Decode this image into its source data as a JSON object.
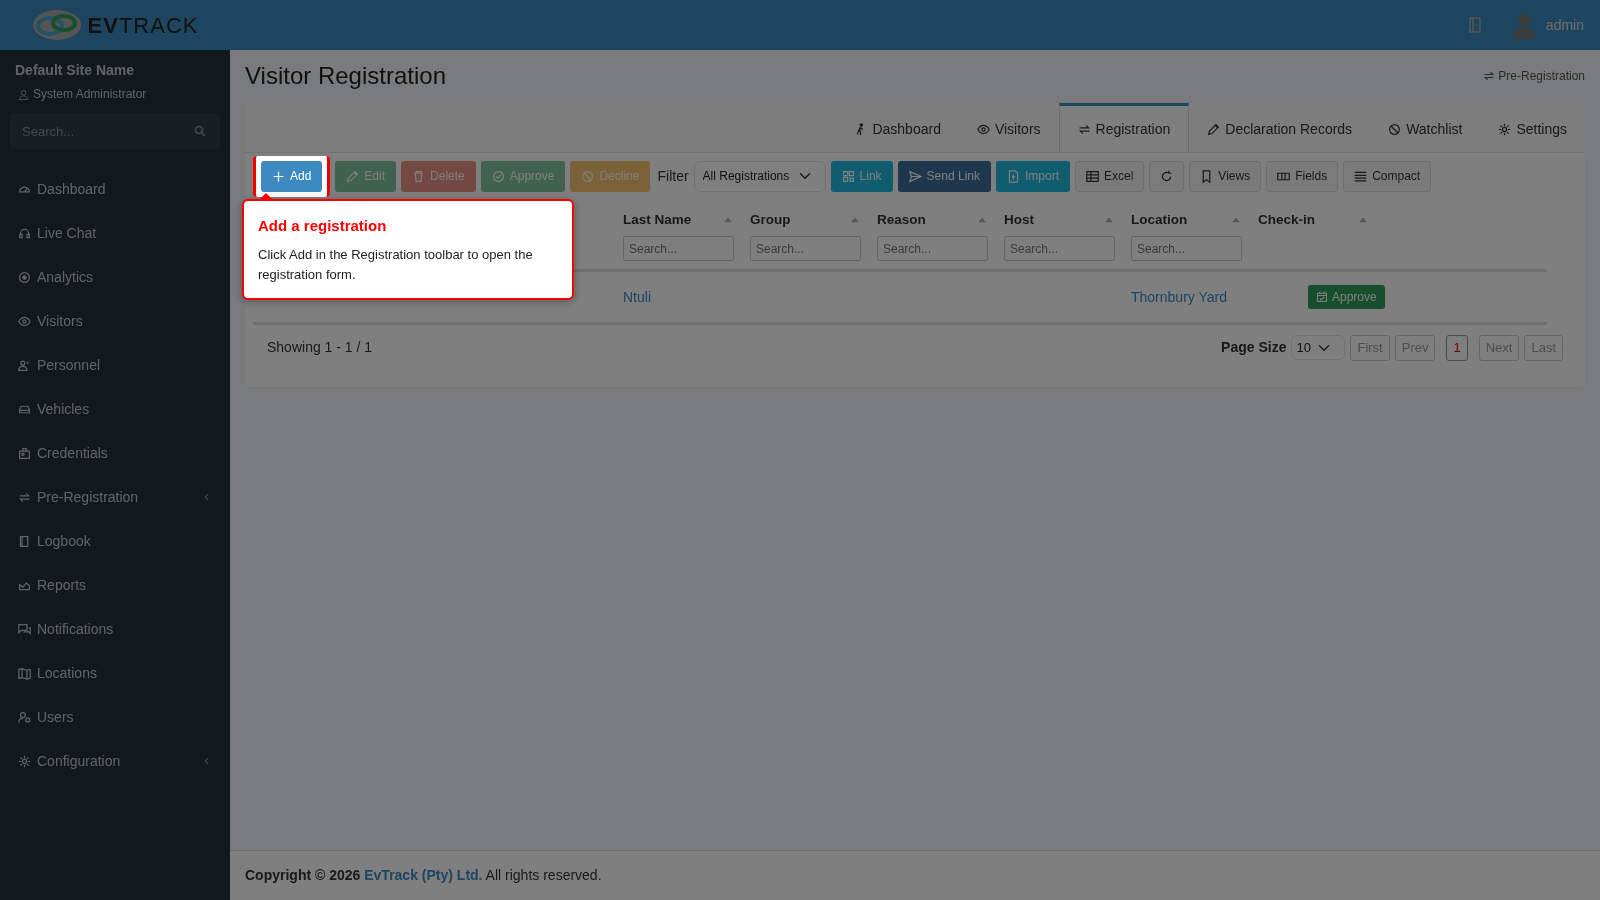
{
  "header": {
    "logo_text": "**EV**TRACK",
    "user": "admin"
  },
  "sidebar": {
    "site_name": "Default Site Name",
    "role": "System Administrator",
    "search": {
      "placeholder": "Search..."
    },
    "items": [
      {
        "label": "Dashboard",
        "has_submenu": false
      },
      {
        "label": "Live Chat",
        "has_submenu": false
      },
      {
        "label": "Analytics",
        "has_submenu": false
      },
      {
        "label": "Visitors",
        "has_submenu": false
      },
      {
        "label": "Personnel",
        "has_submenu": false
      },
      {
        "label": "Vehicles",
        "has_submenu": false
      },
      {
        "label": "Credentials",
        "has_submenu": false
      },
      {
        "label": "Pre-Registration",
        "has_submenu": true
      },
      {
        "label": "Logbook",
        "has_submenu": false
      },
      {
        "label": "Reports",
        "has_submenu": false
      },
      {
        "label": "Notifications",
        "has_submenu": false
      },
      {
        "label": "Locations",
        "has_submenu": false
      },
      {
        "label": "Users",
        "has_submenu": false
      },
      {
        "label": "Configuration",
        "has_submenu": true
      }
    ]
  },
  "page": {
    "title": "Visitor Registration",
    "breadcrumb": "Pre-Registration"
  },
  "tabs": [
    {
      "label": "Dashboard",
      "selected": false
    },
    {
      "label": "Visitors",
      "selected": false
    },
    {
      "label": "Registration",
      "selected": true
    },
    {
      "label": "Declaration Records",
      "selected": false
    },
    {
      "label": "Watchlist",
      "selected": false
    },
    {
      "label": "Settings",
      "selected": false
    }
  ],
  "toolbar": {
    "left_buttons": [
      {
        "label": "Add",
        "kind": "primary",
        "disabled": false
      },
      {
        "label": "Edit",
        "kind": "success",
        "disabled": true
      },
      {
        "label": "Delete",
        "kind": "danger",
        "disabled": true
      },
      {
        "label": "Approve",
        "kind": "success",
        "disabled": true
      },
      {
        "label": "Decline",
        "kind": "warning",
        "disabled": true
      }
    ],
    "filter": {
      "label": "Filter",
      "value": "All Registrations"
    },
    "right_buttons": [
      {
        "label": "Link",
        "kind": "info",
        "disabled": false
      },
      {
        "label": "Send Link",
        "kind": "navy",
        "disabled": false
      },
      {
        "label": "Import",
        "kind": "info",
        "disabled": false
      },
      {
        "label": "Excel",
        "kind": "light",
        "disabled": false
      },
      {
        "kind": "light",
        "disabled": false
      },
      {
        "label": "Views",
        "kind": "light",
        "disabled": false
      },
      {
        "label": "Fields",
        "kind": "light",
        "disabled": false
      },
      {
        "label": "Compact",
        "kind": "light",
        "disabled": false
      }
    ]
  },
  "table": {
    "columns": [
      {
        "label": "Last Name",
        "placeholder": "Search..."
      },
      {
        "label": "Group",
        "placeholder": "Search..."
      },
      {
        "label": "Reason",
        "placeholder": "Search..."
      },
      {
        "label": "Host",
        "placeholder": "Search..."
      },
      {
        "label": "Location",
        "placeholder": "Search..."
      },
      {
        "label": "Check-in"
      }
    ],
    "rows": [
      {
        "last_name": "Ntuli",
        "location": "Thornbury Yard",
        "action": "Approve"
      }
    ]
  },
  "pagination": {
    "showing": "Showing 1 - 1 / 1",
    "page_size_label": "Page Size",
    "page_size": "10",
    "pages": [
      {
        "label": "First",
        "disabled": true,
        "selected": false
      },
      {
        "label": "Prev",
        "disabled": true,
        "selected": false
      },
      {
        "label": "1",
        "disabled": false,
        "selected": true
      },
      {
        "label": "Next",
        "disabled": true,
        "selected": false
      },
      {
        "label": "Last",
        "disabled": true,
        "selected": false
      }
    ]
  },
  "tour": {
    "title": "Add a registration",
    "text": "Click Add in the Registration toolbar to open the registration form."
  },
  "footer": {
    "prefix": "Copyright © 2026",
    "link": "EvTrack (Pty) Ltd.",
    "suffix": "All rights reserved."
  }
}
